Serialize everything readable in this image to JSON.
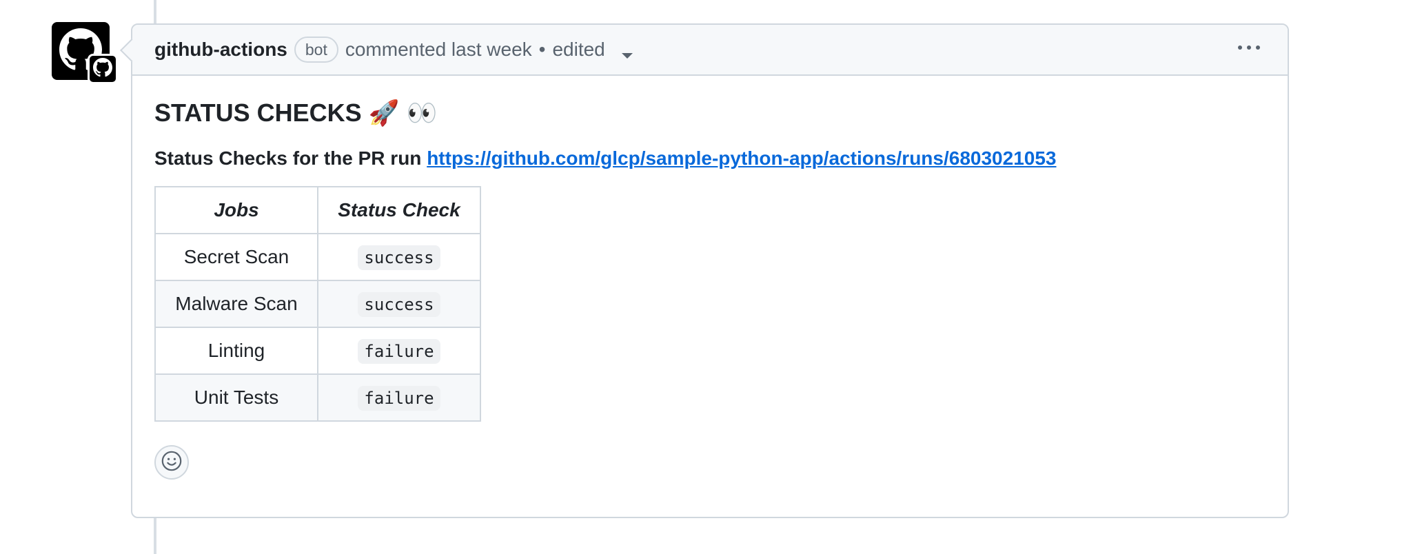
{
  "comment": {
    "author": "github-actions",
    "badge": "bot",
    "action": "commented last week",
    "separator": "•",
    "edited_label": "edited",
    "title": "STATUS CHECKS 🚀 👀",
    "intro_text": "Status Checks for the PR run",
    "run_url": "https://github.com/glcp/sample-python-app/actions/runs/6803021053",
    "table": {
      "headers": [
        "Jobs",
        "Status Check"
      ],
      "rows": [
        {
          "job": "Secret Scan",
          "status": "success"
        },
        {
          "job": "Malware Scan",
          "status": "success"
        },
        {
          "job": "Linting",
          "status": "failure"
        },
        {
          "job": "Unit Tests",
          "status": "failure"
        }
      ]
    }
  },
  "icons": {
    "avatar": "github-octocat-icon",
    "badge": "github-app-icon",
    "menu": "kebab-horizontal-icon",
    "dropdown": "triangle-down-icon",
    "reaction": "smiley-icon"
  },
  "colors": {
    "link": "#0969da",
    "border": "#d0d7de",
    "header_bg": "#f6f8fa",
    "muted_text": "#59636e"
  }
}
